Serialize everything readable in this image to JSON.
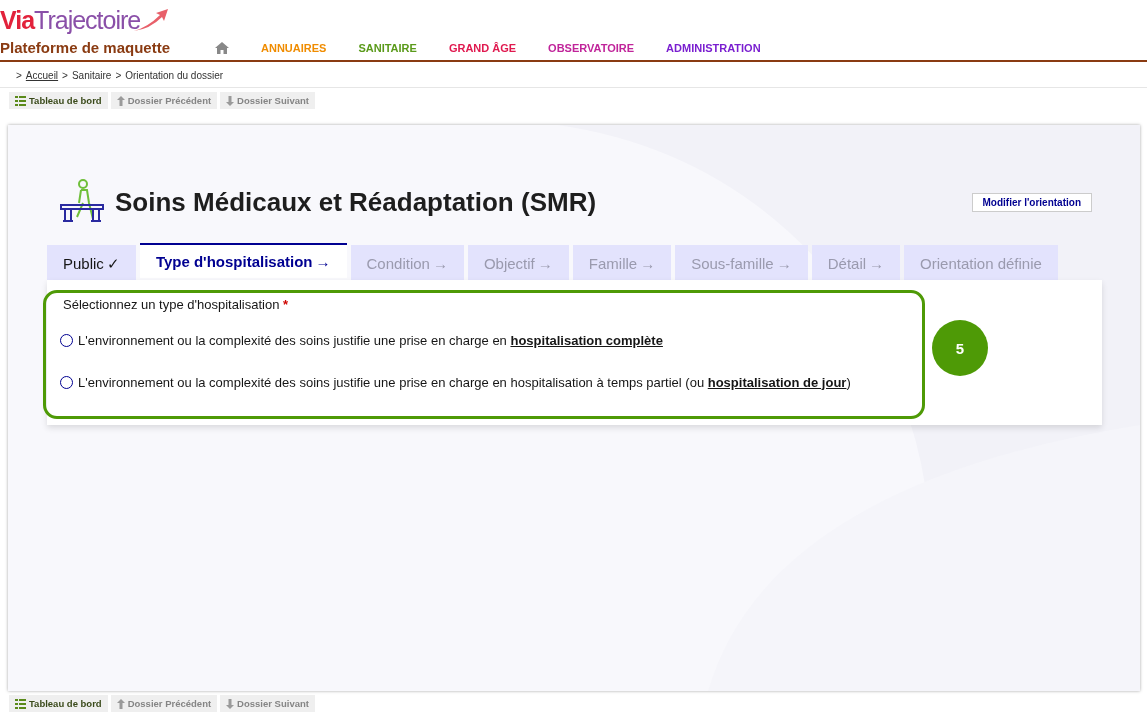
{
  "logo": {
    "prefix": "Via",
    "name": "Trajectoire"
  },
  "platform": "Plateforme de maquette",
  "nav": [
    {
      "label": "ANNUAIRES",
      "color": "#f08c00"
    },
    {
      "label": "SANITAIRE",
      "color": "#5a9a1a"
    },
    {
      "label": "GRAND ÂGE",
      "color": "#e0194f"
    },
    {
      "label": "OBSERVATOIRE",
      "color": "#c0249a"
    },
    {
      "label": "ADMINISTRATION",
      "color": "#7a1fd0"
    }
  ],
  "breadcrumb": {
    "separator": ">",
    "items": [
      {
        "label": "Accueil",
        "link": true
      },
      {
        "label": "Sanitaire",
        "link": false
      },
      {
        "label": "Orientation du dossier",
        "link": false
      }
    ]
  },
  "toolbar": [
    {
      "label": "Tableau de bord",
      "disabled": false
    },
    {
      "label": "Dossier Précédent",
      "disabled": true
    },
    {
      "label": "Dossier Suivant",
      "disabled": true
    }
  ],
  "title": "Soins Médicaux et Réadaptation (SMR)",
  "modify_button": "Modifier l'orientation",
  "tabs": [
    {
      "label": "Public",
      "mark": "✓",
      "selected": false,
      "done": true
    },
    {
      "label": "Type d'hospitalisation",
      "mark": "→",
      "selected": true,
      "done": false
    },
    {
      "label": "Condition",
      "mark": "→",
      "selected": false,
      "done": false
    },
    {
      "label": "Objectif",
      "mark": "→",
      "selected": false,
      "done": false
    },
    {
      "label": "Famille",
      "mark": "→",
      "selected": false,
      "done": false
    },
    {
      "label": "Sous-famille",
      "mark": "→",
      "selected": false,
      "done": false
    },
    {
      "label": "Détail",
      "mark": "→",
      "selected": false,
      "done": false
    },
    {
      "label": "Orientation définie",
      "selected": false,
      "done": false
    }
  ],
  "question": {
    "label": "Sélectionnez un type d'hospitalisation",
    "required_mark": "*"
  },
  "options": [
    {
      "text": "L'environnement ou la complexité des soins justifie une prise en charge en ",
      "link": "hospitalisation complète",
      "selected": false
    },
    {
      "text": "L'environnement ou la complexité des soins justifie une prise en charge en hospitalisation à temps partiel (ou ",
      "link": "hospitalisation de jour",
      "suffix": ")",
      "selected": false
    }
  ],
  "annotation": {
    "label": "5"
  },
  "bottom_toolbar": [
    {
      "label": "Tableau de bord",
      "disabled": false
    },
    {
      "label": "Dossier Précédent",
      "disabled": true
    },
    {
      "label": "Dossier Suivant",
      "disabled": true
    }
  ]
}
